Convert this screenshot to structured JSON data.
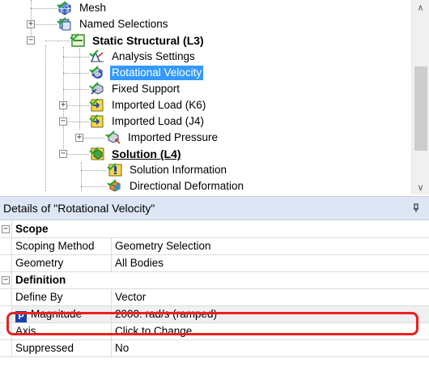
{
  "tree": {
    "items": [
      {
        "label": "Mesh"
      },
      {
        "label": "Named Selections"
      },
      {
        "label": "Static Structural (L3)"
      },
      {
        "label": "Analysis Settings"
      },
      {
        "label": "Rotational Velocity"
      },
      {
        "label": "Fixed Support"
      },
      {
        "label": "Imported Load (K6)"
      },
      {
        "label": "Imported Load (J4)"
      },
      {
        "label": "Imported Pressure"
      },
      {
        "label": "Solution (L4)"
      },
      {
        "label": "Solution Information"
      },
      {
        "label": "Directional Deformation"
      }
    ]
  },
  "details": {
    "title": "Details of \"Rotational Velocity\"",
    "pin_glyph": "ᵖ",
    "sections": [
      {
        "name": "Scope",
        "rows": [
          {
            "name": "Scoping Method",
            "value": "Geometry Selection"
          },
          {
            "name": "Geometry",
            "value": "All Bodies"
          }
        ]
      },
      {
        "name": "Definition",
        "rows": [
          {
            "name": "Define By",
            "value": "Vector"
          },
          {
            "name": "Magnitude",
            "value": "2000. rad/s  (ramped)",
            "param_badge": "P"
          },
          {
            "name": "Axis",
            "value": "Click to Change"
          },
          {
            "name": "Suppressed",
            "value": "No"
          }
        ]
      }
    ]
  },
  "colors": {
    "selection": "#3399ff",
    "header_bg": "#dce6f4",
    "highlight": "#e8221e",
    "check": "#2aa82a"
  }
}
